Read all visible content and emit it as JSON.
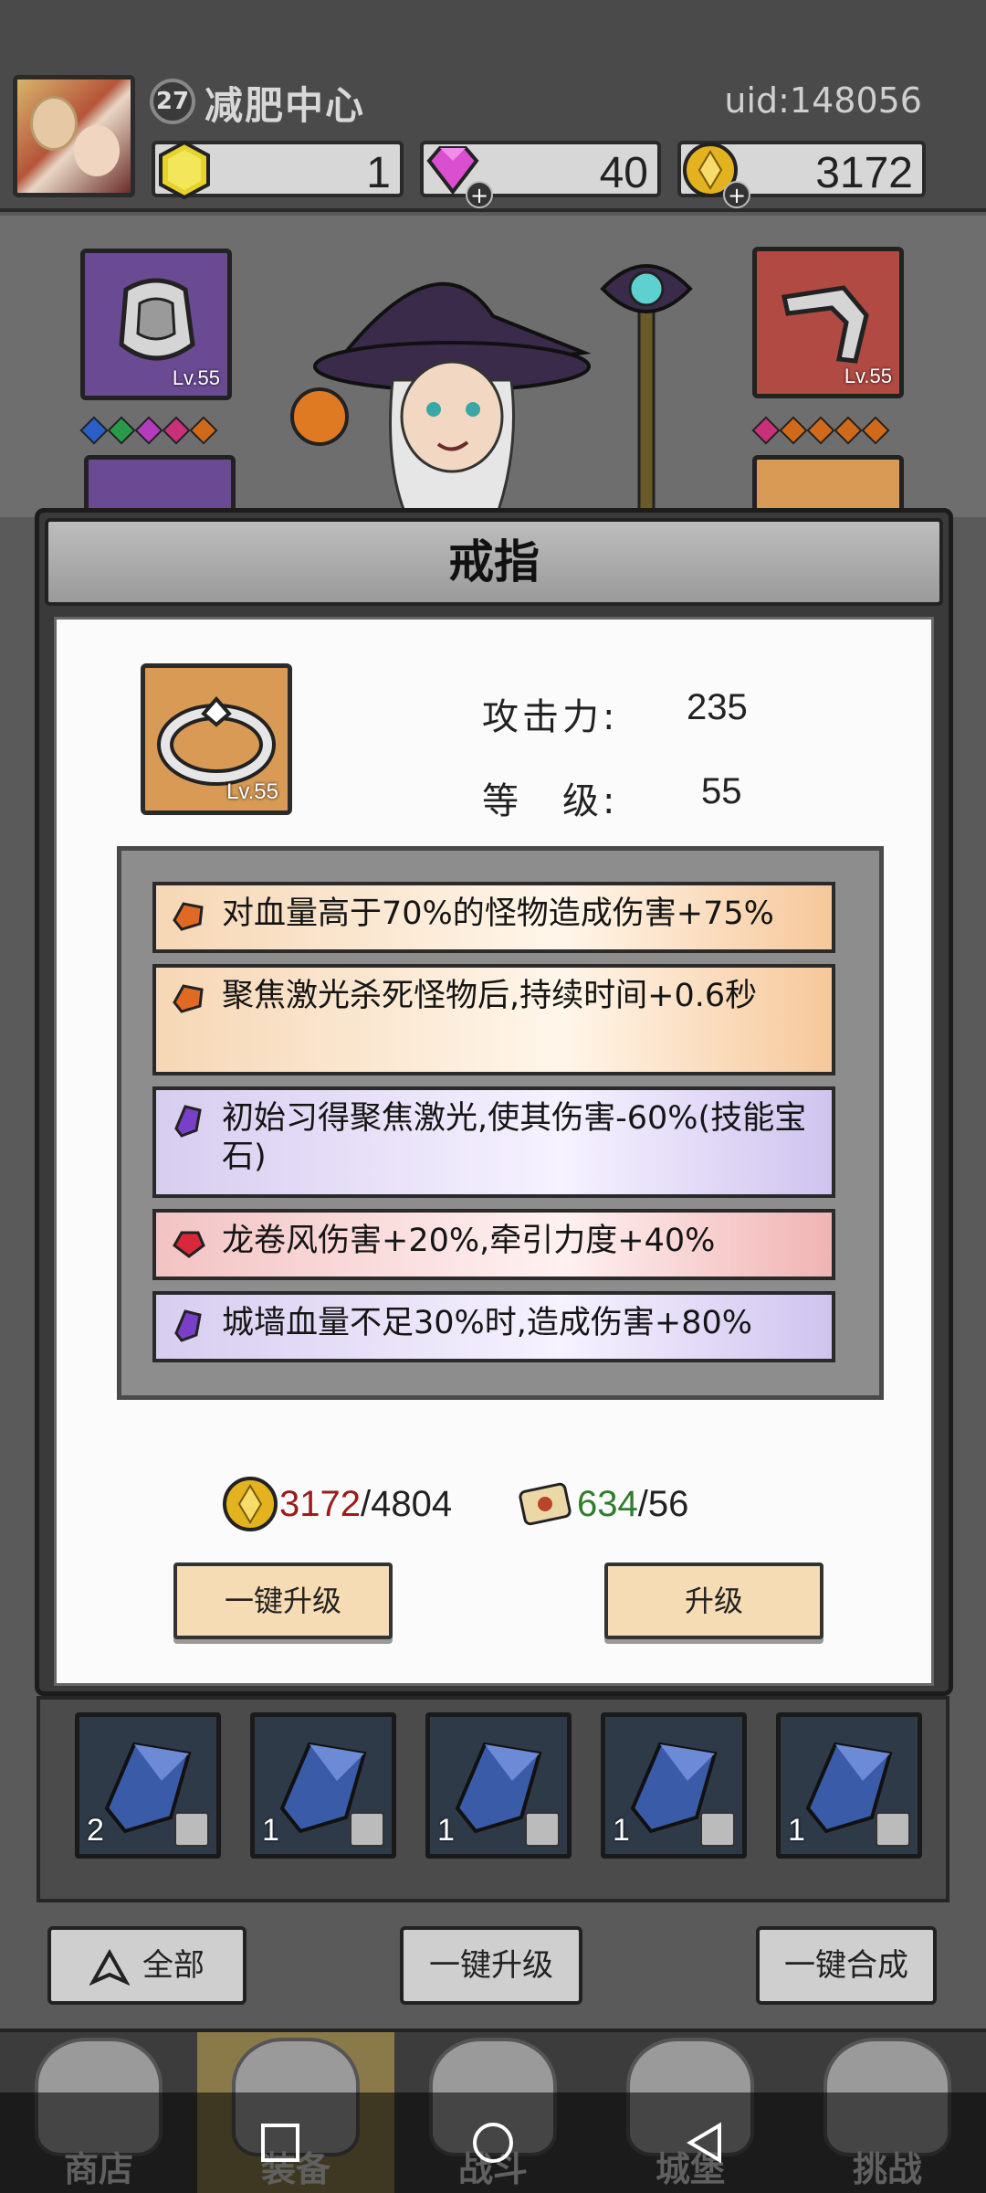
{
  "header": {
    "level": "27",
    "player_name": "减肥中心",
    "uid": "uid:148056",
    "currencies": [
      {
        "icon": "yellow-gem-icon",
        "value": "1"
      },
      {
        "icon": "purple-diamond-icon",
        "value": "40"
      },
      {
        "icon": "gold-coin-icon",
        "value": "3172"
      }
    ]
  },
  "equipment": {
    "left_top_level": "Lv.55",
    "right_top_level": "Lv.55",
    "left_gem_colors": [
      "#2a5fc8",
      "#2a9a4a",
      "#b43bbd",
      "#c9307a",
      "#d06a1a"
    ],
    "right_gem_colors": [
      "#c9307a",
      "#d06a1a",
      "#d06a1a",
      "#d06a1a",
      "#d06a1a"
    ]
  },
  "dialog": {
    "title": "戒指",
    "item_level": "Lv.55",
    "attack_label": "攻击力:",
    "attack_value": "235",
    "level_label": "等　级:",
    "level_value": "55",
    "effects": [
      {
        "gem": "orange",
        "text": "对血量高于70%的怪物造成伤害+75%"
      },
      {
        "gem": "orange",
        "text": "聚焦激光杀死怪物后,持续时间+0.6秒"
      },
      {
        "gem": "purple",
        "text": "初始习得聚焦激光,使其伤害-60%(技能宝石)"
      },
      {
        "gem": "red",
        "text": "龙卷风伤害+20%,牵引力度+40%"
      },
      {
        "gem": "purple",
        "text": "城墙血量不足30%时,造成伤害+80%"
      }
    ],
    "gold_have": "3172",
    "gold_need": "/4804",
    "scroll_have": "634",
    "scroll_need": "/56",
    "btn_upgrade_all": "一键升级",
    "btn_upgrade": "升级"
  },
  "inventory": {
    "slots": [
      {
        "count": "2"
      },
      {
        "count": "1"
      },
      {
        "count": "1"
      },
      {
        "count": "1"
      },
      {
        "count": "1"
      }
    ]
  },
  "actions": {
    "filter_all": "全部",
    "upgrade_all": "一键升级",
    "merge_all": "一键合成"
  },
  "nav": {
    "items": [
      {
        "label": "商店"
      },
      {
        "label": "装备"
      },
      {
        "label": "战斗"
      },
      {
        "label": "城堡"
      },
      {
        "label": "挑战"
      }
    ]
  }
}
